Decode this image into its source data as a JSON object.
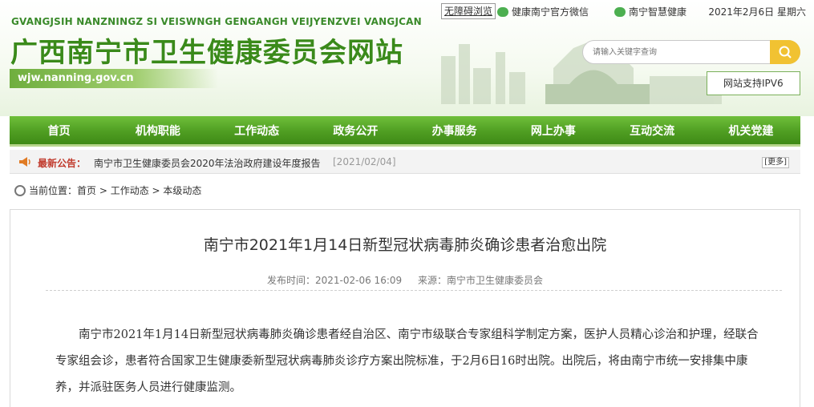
{
  "topbar": {
    "accessibility": "无障碍浏览",
    "wechat": "健康南宁官方微信",
    "smart": "南宁智慧健康",
    "date": "2021年2月6日 星期六"
  },
  "header": {
    "pinyin": "GVANGJSIH NANZNINGZ SI VEISWNGH GENGANGH VEIJYENZVEI VANGJCAN",
    "title": "广西南宁市卫生健康委员会网站",
    "url": "wjw.nanning.gov.cn",
    "search_placeholder": "请输入关键字查询",
    "ipv6": "网站支持IPV6"
  },
  "nav": [
    "首页",
    "机构职能",
    "工作动态",
    "政务公开",
    "办事服务",
    "网上办事",
    "互动交流",
    "机关党建"
  ],
  "notice": {
    "label": "最新公告：",
    "text": "南宁市卫生健康委员会2020年法治政府建设年度报告",
    "date": "[2021/02/04]",
    "more": "[更多]"
  },
  "breadcrumb": {
    "prefix": "当前位置：",
    "items": [
      "首页",
      "工作动态",
      "本级动态"
    ],
    "sep": " > "
  },
  "article": {
    "title": "南宁市2021年1月14日新型冠状病毒肺炎确诊患者治愈出院",
    "published": "发布时间：2021-02-06 16:09",
    "source": "来源：南宁市卫生健康委员会",
    "body": "南宁市2021年1月14日新型冠状病毒肺炎确诊患者经自治区、南宁市级联合专家组科学制定方案，医护人员精心诊治和护理，经联合专家组会诊，患者符合国家卫生健康委新型冠状病毒肺炎诊疗方案出院标准，于2月6日16时出院。出院后，将由南宁市统一安排集中康养，并派驻医务人员进行健康监测。"
  },
  "colors": {
    "brand_green": "#4f9e22",
    "title_green": "#3a8a1a",
    "notice_red": "#c0392b",
    "search_btn": "#f1c232"
  }
}
